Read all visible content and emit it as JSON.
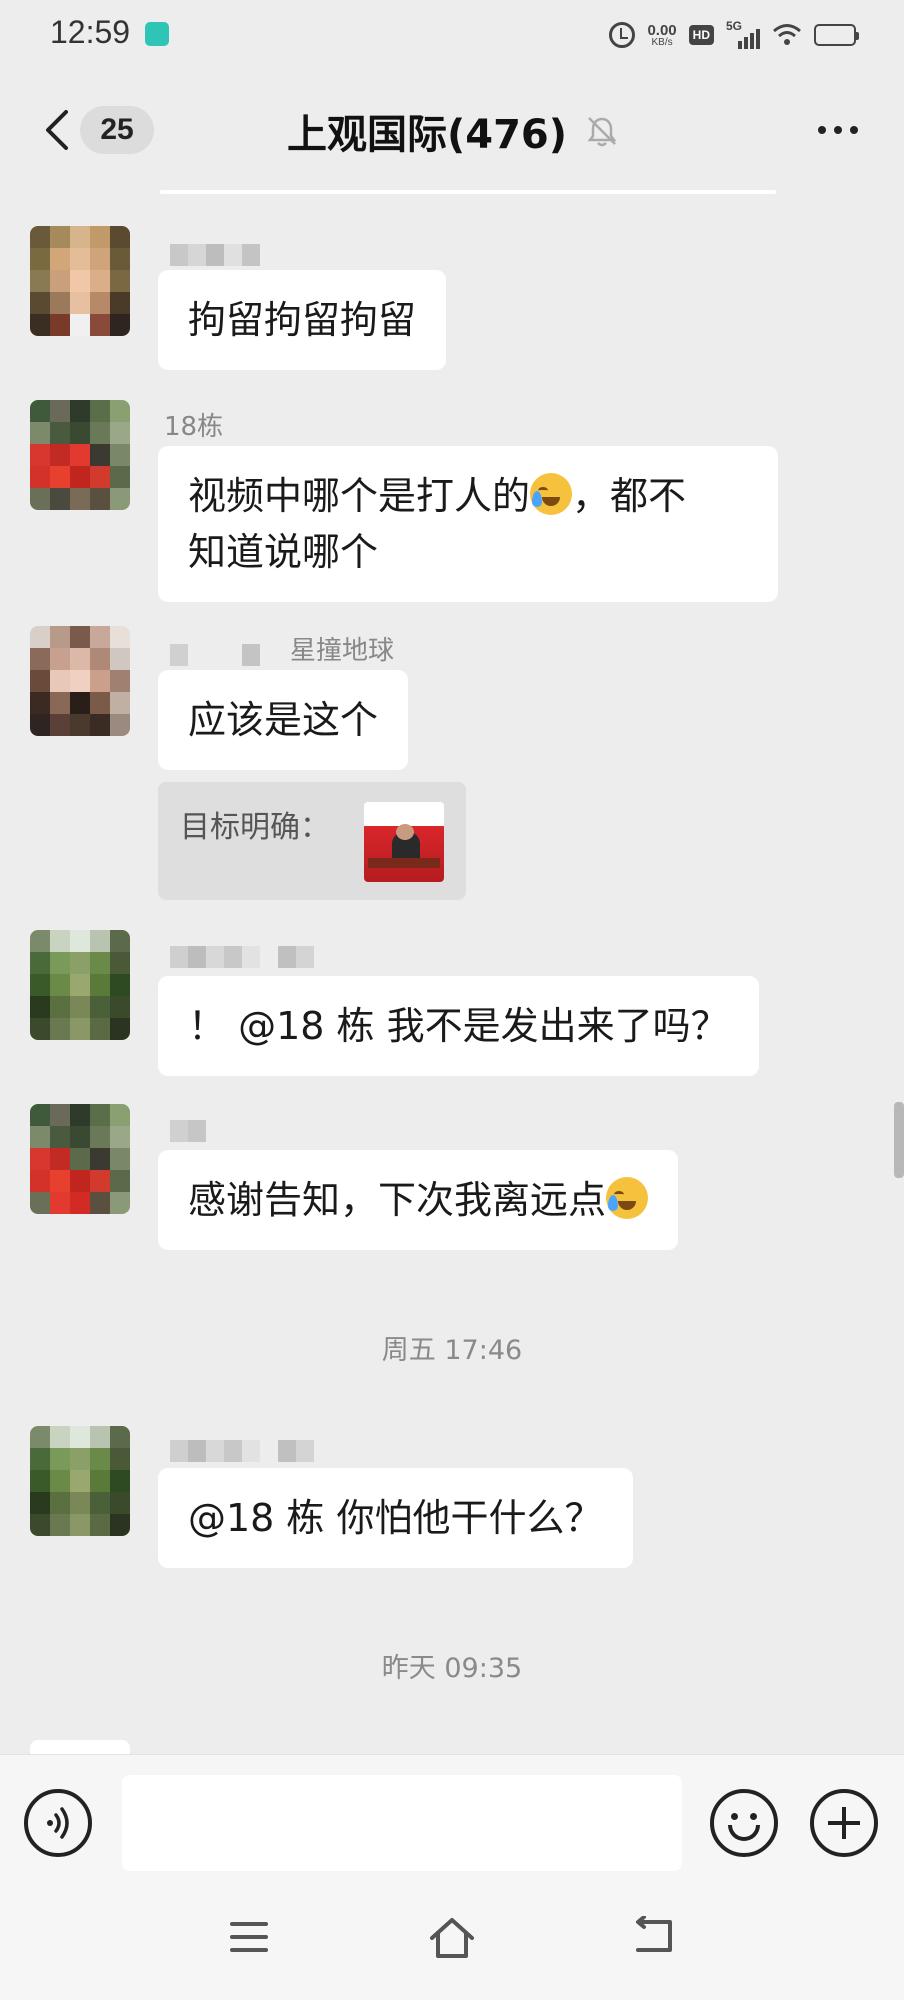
{
  "status_bar": {
    "time": "12:59",
    "net_speed_value": "0.00",
    "net_speed_unit": "KB/s",
    "hd_label": "HD",
    "network_label": "5G"
  },
  "header": {
    "unread_count": "25",
    "title": "上观国际(476)"
  },
  "messages": [
    {
      "sender": "",
      "text": "拘留拘留拘留"
    },
    {
      "sender": "18栋",
      "text_before_emoji": "视频中哪个是打人的",
      "text_after_emoji": "，都不",
      "text_line2": "知道说哪个"
    },
    {
      "sender": "星撞地球",
      "text": "应该是这个",
      "quote_text": "目标明确："
    },
    {
      "sender": "",
      "text": "！ @18 栋  我不是发出来了吗？"
    },
    {
      "sender": "",
      "text": "感谢告知，下次我离远点"
    },
    {
      "sender": "",
      "text": "@18 栋  你怕他干什么？"
    }
  ],
  "time_separators": [
    "周五 17:46",
    "昨天 09:35"
  ],
  "input": {
    "placeholder": "",
    "value": ""
  },
  "icons": {
    "back": "chevron-left-icon",
    "mute": "bell-off-icon",
    "more": "more-dots-icon",
    "voice": "voice-icon",
    "emoji": "smile-icon",
    "plus": "plus-icon",
    "nav_menu": "menu-icon",
    "nav_home": "home-icon",
    "nav_back": "back-icon"
  }
}
